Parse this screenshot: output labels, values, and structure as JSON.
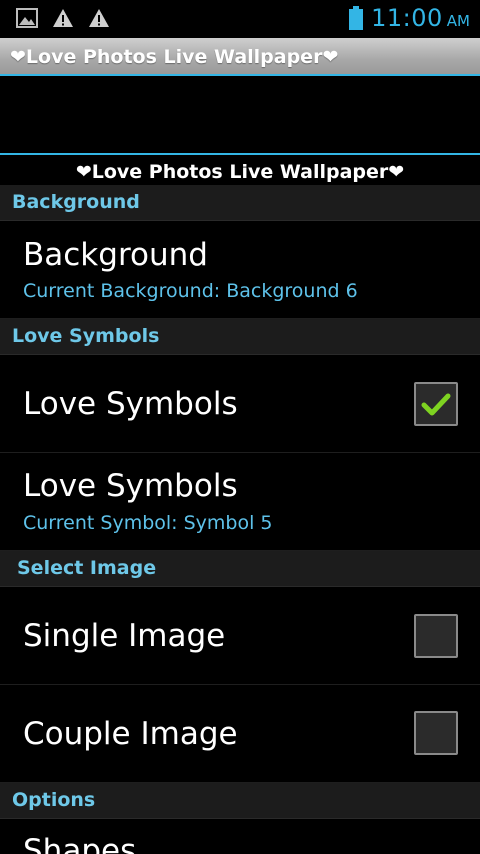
{
  "status_bar": {
    "icons": [
      "image-icon",
      "warning-icon",
      "warning-icon"
    ],
    "time": "11:00",
    "ampm": "AM",
    "accent": "#33b5e5"
  },
  "app_bar": {
    "title": "❤Love Photos Live Wallpaper❤"
  },
  "screen_title": "❤Love Photos Live Wallpaper❤",
  "categories": {
    "background": "Background",
    "love_symbols": "Love Symbols",
    "select_image": "Select Image",
    "options": "Options"
  },
  "prefs": {
    "background": {
      "title": "Background",
      "summary": "Current Background: Background 6"
    },
    "love_symbols_toggle": {
      "title": "Love Symbols",
      "checked": true
    },
    "love_symbols_select": {
      "title": "Love Symbols",
      "summary": "Current Symbol: Symbol 5"
    },
    "single_image": {
      "title": "Single Image",
      "checked": false
    },
    "couple_image": {
      "title": "Couple Image",
      "checked": false
    },
    "shapes": {
      "title": "Shapes"
    }
  }
}
